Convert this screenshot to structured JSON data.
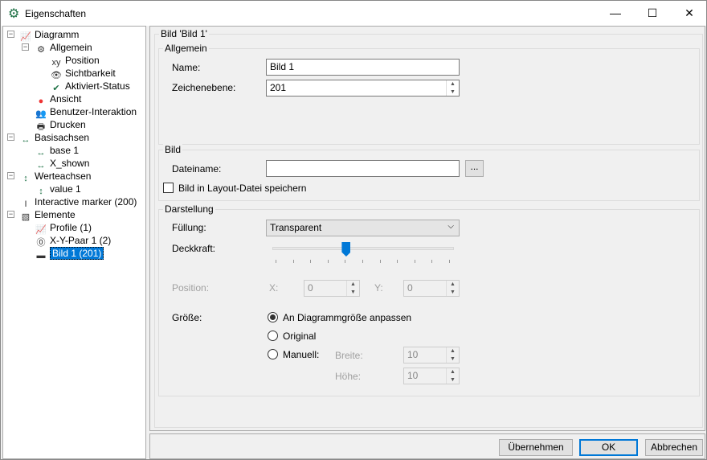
{
  "window": {
    "title": "Eigenschaften",
    "minimize": "—",
    "maximize": "☐",
    "close": "✕"
  },
  "tree": [
    {
      "label": "Diagramm",
      "icon": "chart-icon"
    },
    {
      "label": "Allgemein",
      "icon": "gear-icon"
    },
    {
      "label": "Position",
      "icon": "xy-position-icon"
    },
    {
      "label": "Sichtbarkeit",
      "icon": "eye-icon"
    },
    {
      "label": "Aktiviert-Status",
      "icon": "check-circle-icon"
    },
    {
      "label": "Ansicht",
      "icon": "color-circles-icon"
    },
    {
      "label": "Benutzer-Interaktion",
      "icon": "users-icon"
    },
    {
      "label": "Drucken",
      "icon": "printer-icon"
    },
    {
      "label": "Basisachsen",
      "icon": "x-axis-icon"
    },
    {
      "label": "base 1",
      "icon": "x-axis-icon"
    },
    {
      "label": "X_shown",
      "icon": "x-axis-icon"
    },
    {
      "label": "Werteachsen",
      "icon": "y-axis-icon"
    },
    {
      "label": "value 1",
      "icon": "y-axis-icon"
    },
    {
      "label": "Interactive marker (200)",
      "icon": "marker-icon"
    },
    {
      "label": "Elemente",
      "icon": "elements-icon"
    },
    {
      "label": "Profile (1)",
      "icon": "chart-icon"
    },
    {
      "label": "X-Y-Paar 1 (2)",
      "icon": "xy-pair-icon"
    },
    {
      "label": "Bild 1 (201)",
      "icon": "image-icon"
    }
  ],
  "main": {
    "group_title": "Bild 'Bild 1'",
    "allgemein": {
      "title": "Allgemein",
      "name_label": "Name:",
      "name_value": "Bild 1",
      "layer_label": "Zeichenebene:",
      "layer_value": "201"
    },
    "bild": {
      "title": "Bild",
      "file_label": "Dateiname:",
      "file_value": "",
      "browse": "...",
      "save_label": "Bild in Layout-Datei speichern",
      "save_checked": false
    },
    "darstellung": {
      "title": "Darstellung",
      "fill_label": "Füllung:",
      "fill_value": "Transparent",
      "opacity_label": "Deckkraft:",
      "opacity_fraction": 0.4,
      "position_label": "Position:",
      "x_label": "X:",
      "x_value": "0",
      "y_label": "Y:",
      "y_value": "0",
      "size_label": "Größe:",
      "size_options": [
        "An Diagrammgröße anpassen",
        "Original",
        "Manuell:"
      ],
      "size_selected": 0,
      "width_label": "Breite:",
      "width_value": "10",
      "height_label": "Höhe:",
      "height_value": "10"
    }
  },
  "buttons": {
    "apply": "Übernehmen",
    "ok": "OK",
    "cancel": "Abbrechen"
  },
  "colors": {
    "accent": "#0078d7",
    "green": "#1e7145"
  }
}
